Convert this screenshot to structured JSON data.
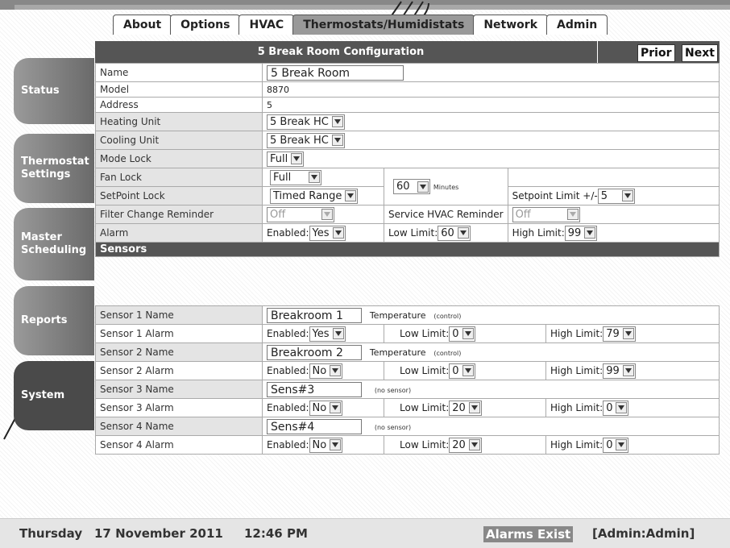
{
  "tabs": [
    {
      "label": "About"
    },
    {
      "label": "Options"
    },
    {
      "label": "HVAC"
    },
    {
      "label": "Thermostats/Humidistats",
      "active": true
    },
    {
      "label": "Network"
    },
    {
      "label": "Admin"
    }
  ],
  "header": {
    "title": "5 Break Room Configuration",
    "prior": "Prior",
    "next": "Next"
  },
  "nav": [
    {
      "label": "Status"
    },
    {
      "label": "Thermostat Settings"
    },
    {
      "label": "Master Scheduling"
    },
    {
      "label": "Reports"
    },
    {
      "label": "System",
      "active": true
    }
  ],
  "config": {
    "name_label": "Name",
    "name_value": "5 Break Room",
    "model_label": "Model",
    "model_value": "8870",
    "address_label": "Address",
    "address_value": "5",
    "heating_label": "Heating Unit",
    "heating_value": "5 Break HC",
    "cooling_label": "Cooling Unit",
    "cooling_value": "5 Break HC",
    "mode_label": "Mode Lock",
    "mode_value": "Full",
    "fan_label": "Fan Lock",
    "fan_value": "Full",
    "setpoint_label": "SetPoint Lock",
    "setpoint_value": "Timed Range",
    "minutes_value": "60",
    "minutes_label": "Minutes",
    "setpoint_limit_label": "Setpoint Limit +/-",
    "setpoint_limit_value": "5",
    "filter_label": "Filter Change Reminder",
    "filter_value": "Off",
    "service_label": "Service HVAC Reminder",
    "service_value": "Off",
    "alarm_label": "Alarm",
    "enabled_label": "Enabled:",
    "alarm_enabled": "Yes",
    "low_limit_label": "Low Limit:",
    "alarm_low": "60",
    "high_limit_label": "High Limit:",
    "alarm_high": "99"
  },
  "sensors": {
    "section_title": "Sensors",
    "items": [
      {
        "name_label": "Sensor 1 Name",
        "name_value": "Breakroom 1",
        "type": "Temperature",
        "note": "(control)",
        "alarm_label": "Sensor 1 Alarm",
        "enabled": "Yes",
        "low": "0",
        "high": "79"
      },
      {
        "name_label": "Sensor 2 Name",
        "name_value": "Breakroom 2",
        "type": "Temperature",
        "note": "(control)",
        "alarm_label": "Sensor 2 Alarm",
        "enabled": "No",
        "low": "0",
        "high": "99"
      },
      {
        "name_label": "Sensor 3 Name",
        "name_value": "Sens#3",
        "type": "",
        "note": "(no sensor)",
        "alarm_label": "Sensor 3 Alarm",
        "enabled": "No",
        "low": "20",
        "high": "0"
      },
      {
        "name_label": "Sensor 4 Name",
        "name_value": "Sens#4",
        "type": "",
        "note": "(no sensor)",
        "alarm_label": "Sensor 4 Alarm",
        "enabled": "No",
        "low": "20",
        "high": "0"
      }
    ]
  },
  "footer": {
    "day": "Thursday",
    "date": "17 November 2011",
    "time": "12:46 PM",
    "alarms": "Alarms Exist",
    "user": "[Admin:Admin]"
  }
}
